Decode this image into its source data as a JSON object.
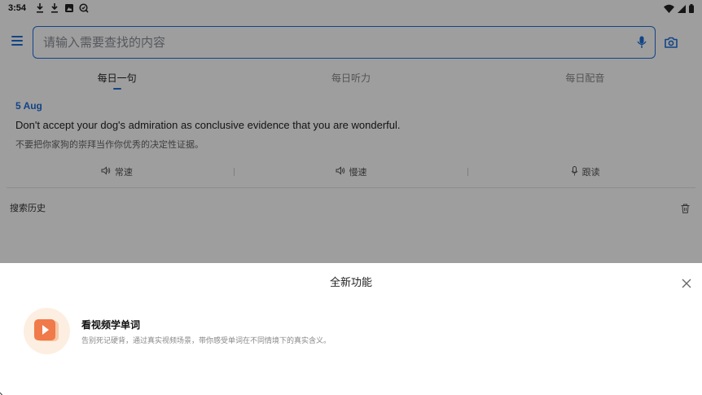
{
  "status_bar": {
    "time": "3:54",
    "icons": [
      "download-icon",
      "download-icon",
      "image-icon",
      "search-app-icon"
    ],
    "right_icons": [
      "wifi-icon",
      "signal-icon",
      "battery-icon"
    ]
  },
  "search": {
    "placeholder": "请输入需要查找的内容",
    "icons": [
      "menu-icon",
      "mic-icon",
      "camera-icon"
    ]
  },
  "tabs": [
    {
      "label": "每日一句",
      "active": true
    },
    {
      "label": "每日听力",
      "active": false
    },
    {
      "label": "每日配音",
      "active": false
    }
  ],
  "daily": {
    "date": "5 Aug",
    "sentence_en": "Don't accept your dog's admiration as conclusive evidence that you are wonderful.",
    "sentence_zh": "不要把你家狗的崇拜当作你优秀的决定性证据。",
    "actions": [
      {
        "label": "常速",
        "icon": "speaker-icon"
      },
      {
        "label": "慢速",
        "icon": "speaker-icon"
      },
      {
        "label": "跟读",
        "icon": "mic-icon"
      }
    ]
  },
  "history": {
    "label": "搜索历史",
    "icon": "trash-icon"
  },
  "sheet": {
    "title": "全新功能",
    "feature_title": "看视频学单词",
    "feature_desc": "告别死记硬背，通过真实视频场景，带你感受单词在不同情境下的真实含义。",
    "accent": "#f07a4a"
  },
  "colors": {
    "primary": "#1e6fd9",
    "overlay": "rgba(0,0,0,0.38)"
  }
}
